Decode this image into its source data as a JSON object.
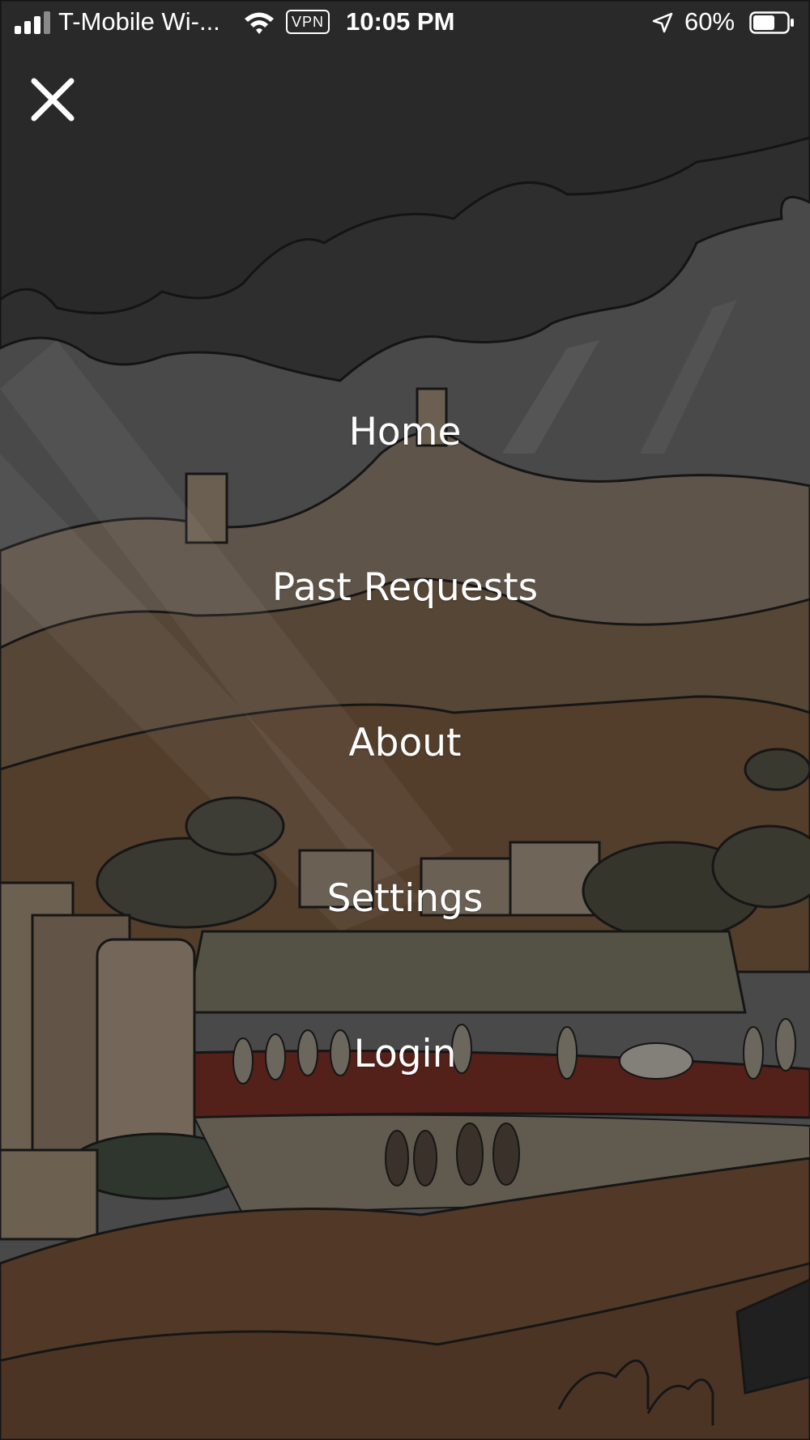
{
  "status_bar": {
    "carrier": "T-Mobile Wi-...",
    "vpn": "VPN",
    "time": "10:05 PM",
    "battery_percent": "60%",
    "icons": [
      "signal-icon",
      "wifi-icon",
      "location-arrow-icon",
      "battery-icon"
    ]
  },
  "close_icon": "close-icon",
  "menu": {
    "items": [
      {
        "label": "Home"
      },
      {
        "label": "Past Requests"
      },
      {
        "label": "About"
      },
      {
        "label": "Settings"
      },
      {
        "label": "Login"
      }
    ]
  },
  "colors": {
    "overlay_text": "#ffffff",
    "sky_cloud": "#3d3d3d",
    "sand": "#6b4a34"
  }
}
